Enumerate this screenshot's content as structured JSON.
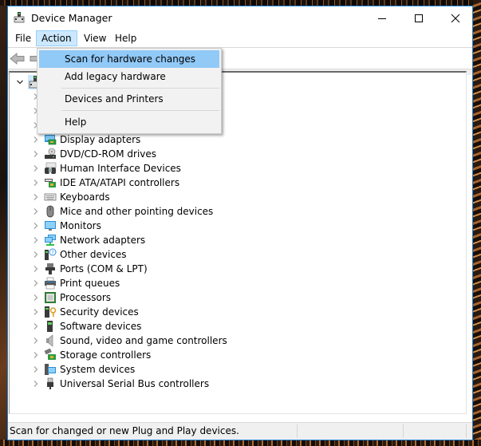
{
  "window": {
    "title": "Device Manager",
    "controls": {
      "minimize": "minimize",
      "maximize": "maximize",
      "close": "close"
    }
  },
  "menubar": {
    "items": [
      {
        "label": "File"
      },
      {
        "label": "Action",
        "active": true
      },
      {
        "label": "View"
      },
      {
        "label": "Help"
      }
    ]
  },
  "toolbar": {
    "buttons": [
      {
        "icon": "back-arrow-icon"
      },
      {
        "icon": "forward-arrow-icon"
      }
    ]
  },
  "action_menu": {
    "items": [
      {
        "label": "Scan for hardware changes",
        "highlighted": true
      },
      {
        "label": "Add legacy hardware"
      },
      {
        "separator": true
      },
      {
        "label": "Devices and Printers"
      },
      {
        "separator": true
      },
      {
        "label": "Help"
      }
    ]
  },
  "tree": {
    "root": {
      "icon": "computer-icon",
      "expanded": true
    },
    "children": [
      {
        "label": "",
        "icon": "device-icon"
      },
      {
        "label": "",
        "icon": "device-icon"
      },
      {
        "label": "",
        "icon": "device-icon"
      },
      {
        "label": "Display adapters",
        "icon": "display-adapter-icon"
      },
      {
        "label": "DVD/CD-ROM drives",
        "icon": "dvd-drive-icon"
      },
      {
        "label": "Human Interface Devices",
        "icon": "hid-icon"
      },
      {
        "label": "IDE ATA/ATAPI controllers",
        "icon": "ide-controller-icon"
      },
      {
        "label": "Keyboards",
        "icon": "keyboard-icon"
      },
      {
        "label": "Mice and other pointing devices",
        "icon": "mouse-icon"
      },
      {
        "label": "Monitors",
        "icon": "monitor-icon"
      },
      {
        "label": "Network adapters",
        "icon": "network-adapter-icon"
      },
      {
        "label": "Other devices",
        "icon": "other-devices-icon"
      },
      {
        "label": "Ports (COM & LPT)",
        "icon": "port-icon"
      },
      {
        "label": "Print queues",
        "icon": "printer-icon"
      },
      {
        "label": "Processors",
        "icon": "processor-icon"
      },
      {
        "label": "Security devices",
        "icon": "security-device-icon"
      },
      {
        "label": "Software devices",
        "icon": "software-device-icon"
      },
      {
        "label": "Sound, video and game controllers",
        "icon": "speaker-icon"
      },
      {
        "label": "Storage controllers",
        "icon": "storage-controller-icon"
      },
      {
        "label": "System devices",
        "icon": "system-devices-icon"
      },
      {
        "label": "Universal Serial Bus controllers",
        "icon": "usb-icon"
      }
    ]
  },
  "statusbar": {
    "text": "Scan for changed or new Plug and Play devices."
  },
  "colors": {
    "window_border": "#1a7fd1",
    "menu_active_bg": "#cce8ff",
    "menu_highlight": "#91c9f7"
  }
}
